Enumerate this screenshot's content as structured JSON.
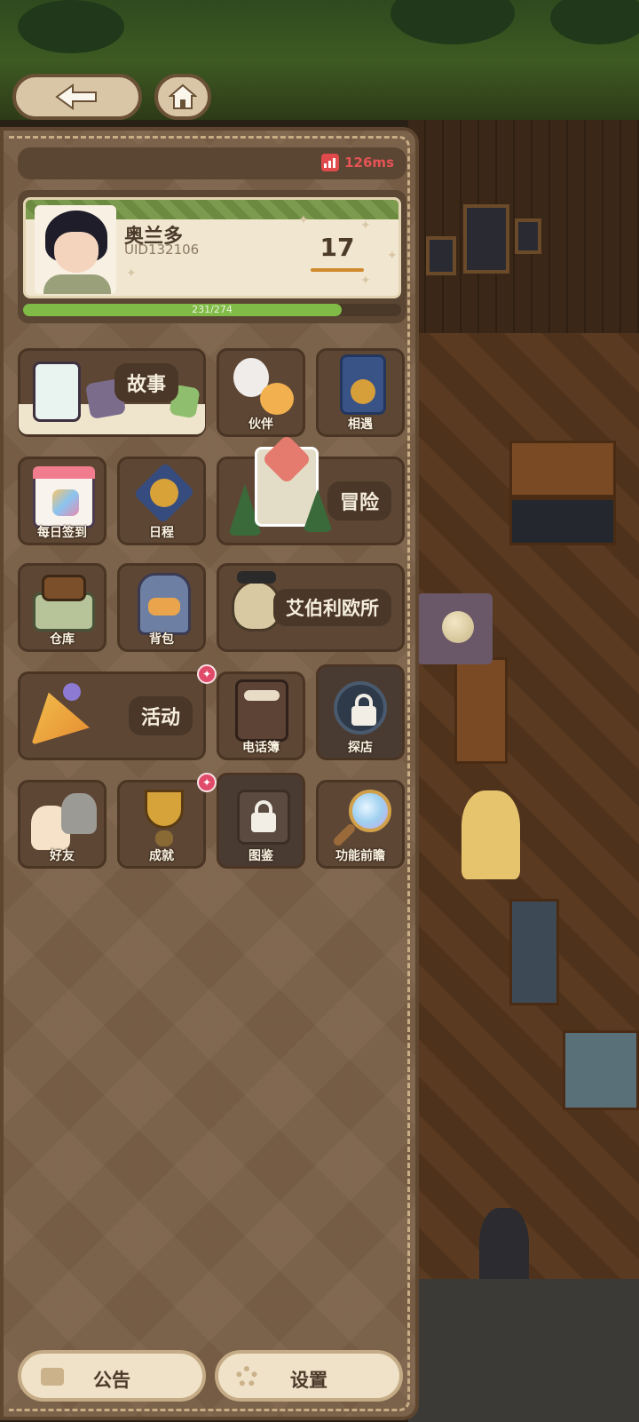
{
  "status": {
    "ping": "126ms"
  },
  "profile": {
    "name": "奥兰多",
    "uid": "UID132106",
    "level": "17",
    "xp_text": "231/274",
    "xp_fraction": 0.843
  },
  "menu": {
    "story": "故事",
    "partners": "伙伴",
    "encounter": "相遇",
    "daily_checkin": "每日签到",
    "schedule": "日程",
    "adventure": "冒险",
    "warehouse": "仓库",
    "backpack": "背包",
    "agency": "艾伯利欧所",
    "events": "活动",
    "phonebook": "电话簿",
    "explore": "探店",
    "friends": "好友",
    "achievements": "成就",
    "codex": "图鉴",
    "feature_preview": "功能前瞻"
  },
  "bottom": {
    "notice": "公告",
    "settings": "设置"
  },
  "colors": {
    "panel": "#7b6048",
    "tile": "#5d4634",
    "xp": "#7fbb46",
    "ping": "#e45454",
    "badge": "#e14b6a"
  },
  "icons": [
    "back-arrow-icon",
    "home-icon",
    "signal-icon",
    "lock-icon",
    "notice-icon",
    "gear-icon"
  ]
}
